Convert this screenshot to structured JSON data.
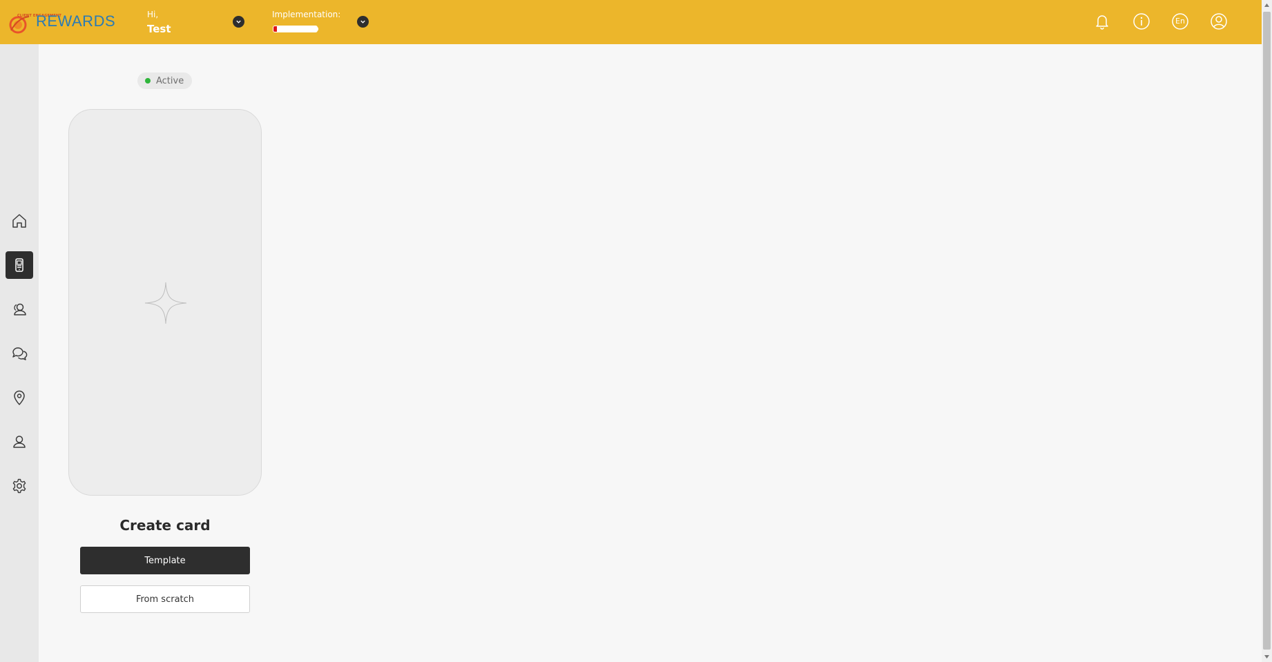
{
  "header": {
    "logo_small_text": "CLIENT ENGAGEMENT",
    "logo_text": "REWARDS",
    "greeting_label": "Hi,",
    "user_name": "Test",
    "implementation_label": "Implementation:",
    "implementation_progress": 0.08,
    "language_label": "En",
    "icons": [
      "bell-icon",
      "info-icon",
      "language-icon",
      "user-account-icon"
    ]
  },
  "sidebar": {
    "items": [
      {
        "name": "home",
        "icon": "home-icon",
        "active": false
      },
      {
        "name": "cards",
        "icon": "mobile-card-icon",
        "active": true
      },
      {
        "name": "clients",
        "icon": "users-icon",
        "active": false
      },
      {
        "name": "messages",
        "icon": "chat-icon",
        "active": false
      },
      {
        "name": "locations",
        "icon": "location-pin-icon",
        "active": false
      },
      {
        "name": "managers",
        "icon": "user-icon",
        "active": false
      },
      {
        "name": "settings",
        "icon": "gear-icon",
        "active": false
      }
    ]
  },
  "main": {
    "status_label": "Active",
    "create_title": "Create card",
    "template_button": "Template",
    "scratch_button": "From scratch"
  },
  "colors": {
    "header_bg": "#ecb62b",
    "sidebar_bg": "#e8e8e8",
    "accent_dark": "#2e2e2e",
    "status_green": "#2fb53b",
    "progress_red": "#e01818",
    "logo_blue": "#2b7bb4"
  }
}
